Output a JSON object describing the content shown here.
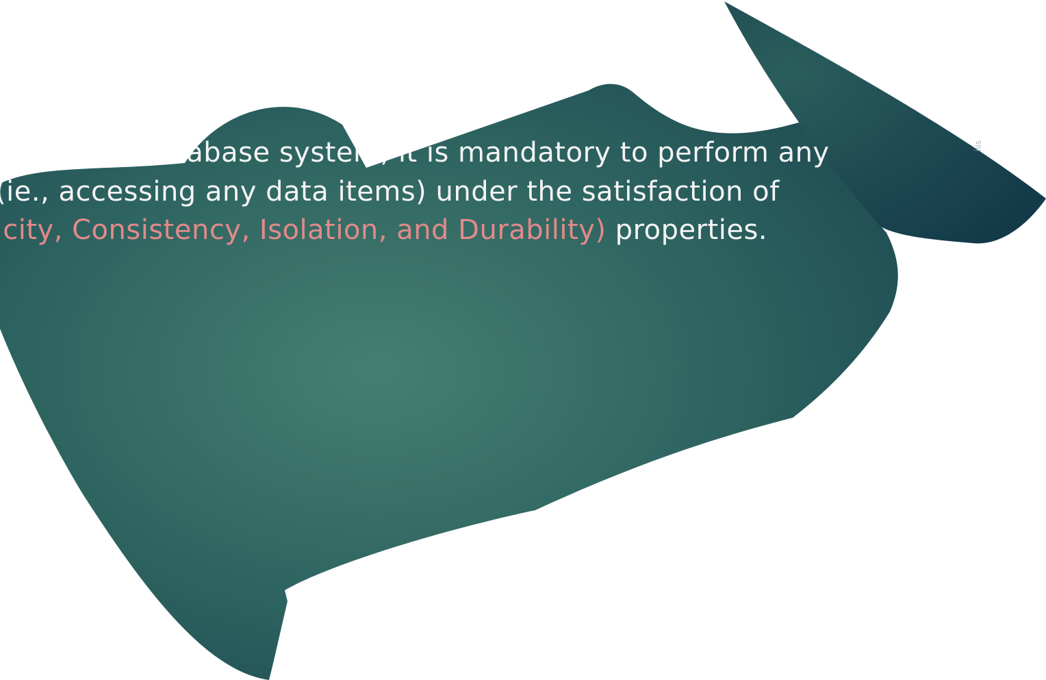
{
  "slide": {
    "line_1": "nized database system, it is mandatory to perform any",
    "line_2_text": "n (ie., accessing any data items) under the satisfaction of",
    "line_3_acid": "tomicity, Consistency, Isolation, and Durability)",
    "line_3_tail": " properties.",
    "side_tag": "ilis"
  },
  "colors": {
    "board_center": "#457f71",
    "board_edge": "#1d4a52",
    "body_text": "#f4f4f4",
    "acid_highlight": "#e28a8a",
    "background": "#ffffff"
  }
}
